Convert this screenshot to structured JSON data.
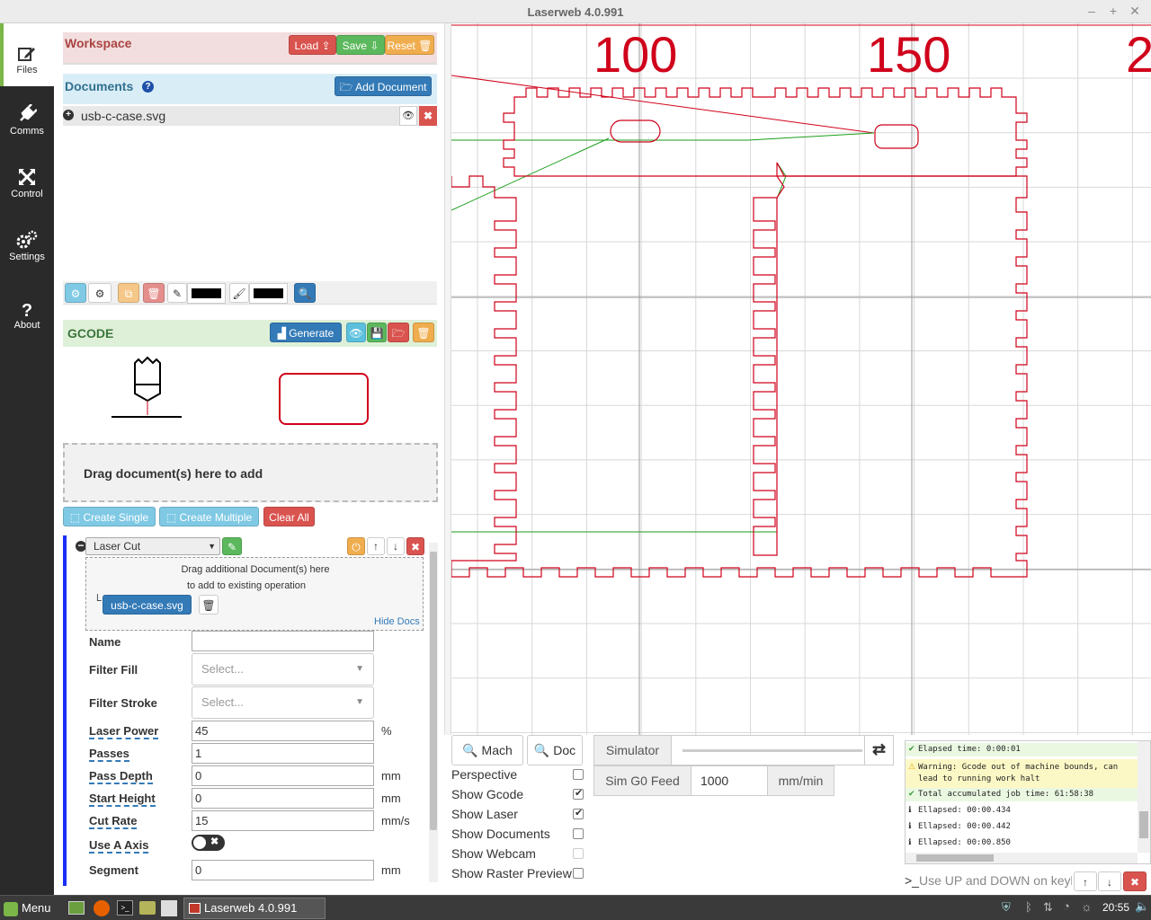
{
  "window": {
    "title": "Laserweb 4.0.991"
  },
  "sidebar": {
    "items": [
      {
        "label": "Files"
      },
      {
        "label": "Comms"
      },
      {
        "label": "Control"
      },
      {
        "label": "Settings"
      },
      {
        "label": "About"
      }
    ]
  },
  "workspace": {
    "title": "Workspace",
    "load_label": "Load",
    "save_label": "Save",
    "reset_label": "Reset"
  },
  "documents": {
    "title": "Documents",
    "add_label": "Add Document",
    "items": [
      {
        "name": "usb-c-case.svg"
      }
    ]
  },
  "toolbar": {
    "fill_color": "#000000",
    "stroke_color": "#000000"
  },
  "gcode": {
    "title": "GCODE",
    "generate_label": "Generate"
  },
  "dropzone": {
    "text": "Drag document(s) here to add"
  },
  "create": {
    "single_label": "Create Single",
    "multiple_label": "Create Multiple",
    "clear_label": "Clear All"
  },
  "operation": {
    "type": "Laser Cut",
    "drag_hint_1": "Drag additional Document(s) here",
    "drag_hint_2": "to add to existing operation",
    "doc_name": "usb-c-case.svg",
    "hide_docs": "Hide Docs",
    "fields": {
      "name": {
        "label": "Name",
        "value": ""
      },
      "filter_fill": {
        "label": "Filter Fill",
        "placeholder": "Select..."
      },
      "filter_stroke": {
        "label": "Filter Stroke",
        "placeholder": "Select..."
      },
      "laser_power": {
        "label": "Laser Power",
        "value": "45",
        "unit": "%"
      },
      "passes": {
        "label": "Passes",
        "value": "1"
      },
      "pass_depth": {
        "label": "Pass Depth",
        "value": "0",
        "unit": "mm"
      },
      "start_height": {
        "label": "Start Height",
        "value": "0",
        "unit": "mm"
      },
      "cut_rate": {
        "label": "Cut Rate",
        "value": "15",
        "unit": "mm/s"
      },
      "use_a_axis": {
        "label": "Use A Axis"
      },
      "segment": {
        "label": "Segment",
        "value": "0",
        "unit": "mm"
      }
    }
  },
  "canvas": {
    "ruler_labels": [
      "100",
      "150",
      "2"
    ],
    "colors": {
      "path": "#d0021b",
      "laser": "#1a9e1a",
      "grid": "#d8d8d8"
    }
  },
  "view_controls": {
    "mach_label": "Mach",
    "doc_label": "Doc",
    "simulator_label": "Simulator",
    "sim_feed_label": "Sim G0 Feed",
    "sim_feed_value": "1000",
    "sim_feed_unit": "mm/min",
    "checks": [
      {
        "label": "Perspective",
        "checked": false
      },
      {
        "label": "Show Gcode",
        "checked": true
      },
      {
        "label": "Show Laser",
        "checked": true
      },
      {
        "label": "Show Documents",
        "checked": false
      },
      {
        "label": "Show Webcam",
        "checked": false
      },
      {
        "label": "Show Raster Preview",
        "checked": false
      }
    ]
  },
  "console": {
    "lines": [
      {
        "type": "success",
        "text": "Elapsed time: 0:00:01"
      },
      {
        "type": "warning",
        "text": "Warning: Gcode out of machine bounds, can lead to running work halt"
      },
      {
        "type": "success",
        "text": "Total accumulated job time: 61:58:38"
      },
      {
        "type": "info",
        "text": "Ellapsed: 00:00.434"
      },
      {
        "type": "info",
        "text": "Ellapsed: 00:00.442"
      },
      {
        "type": "info",
        "text": "Ellapsed: 00:00.850"
      }
    ],
    "input_placeholder": "Use UP and DOWN on keyb"
  },
  "taskbar": {
    "menu_label": "Menu",
    "task_label": "Laserweb 4.0.991",
    "clock": "20:55"
  }
}
